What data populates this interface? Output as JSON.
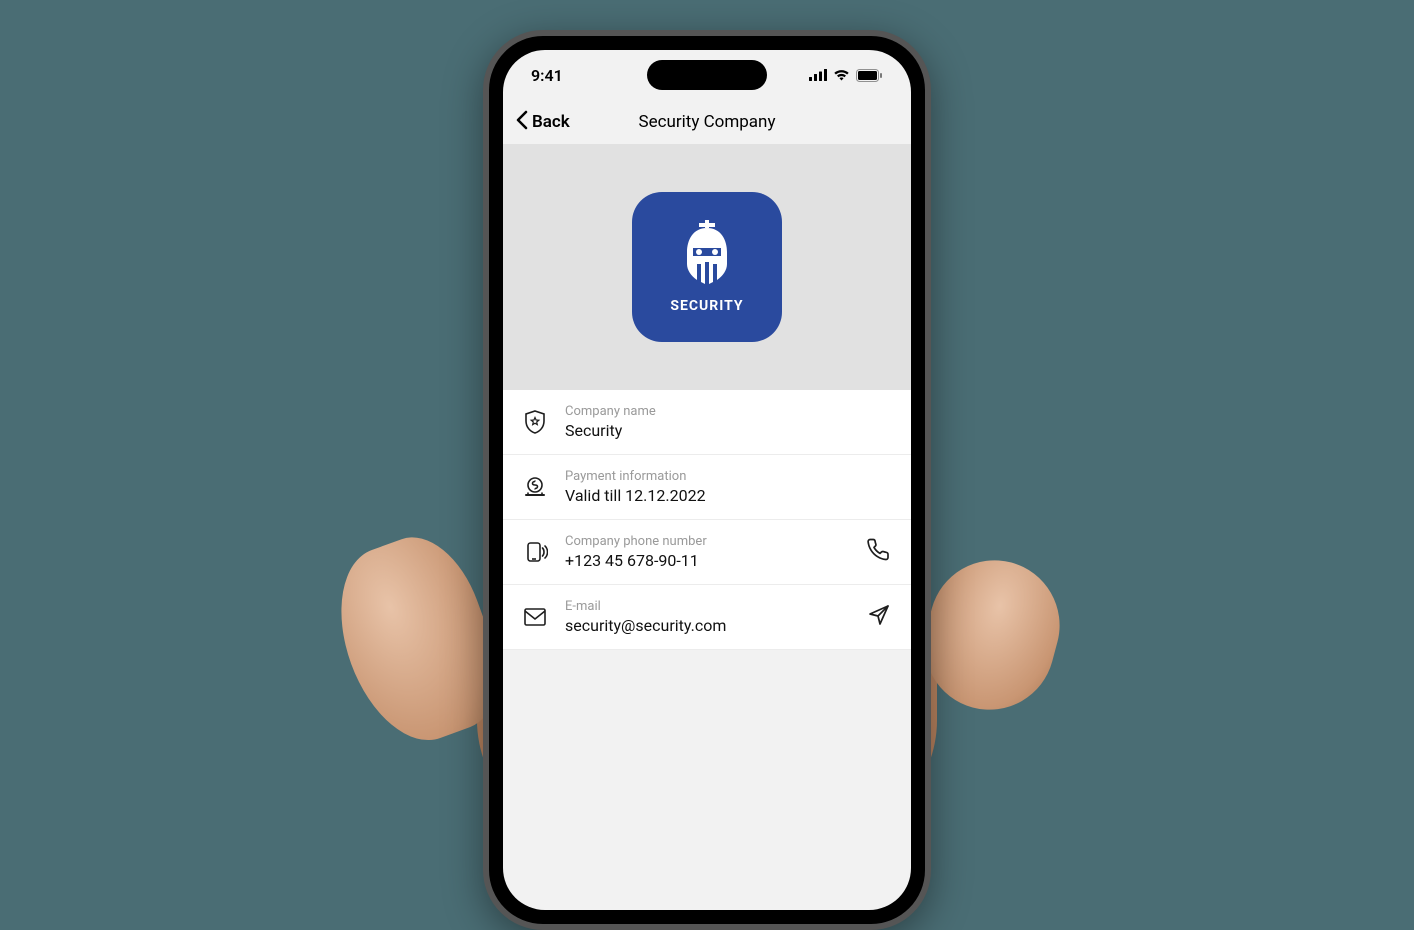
{
  "status": {
    "time": "9:41"
  },
  "nav": {
    "back_label": "Back",
    "title": "Security Company"
  },
  "logo": {
    "label": "SECURITY"
  },
  "rows": {
    "company_name": {
      "label": "Company name",
      "value": "Security"
    },
    "payment": {
      "label": "Payment information",
      "value": "Valid till 12.12.2022"
    },
    "phone": {
      "label": "Company phone number",
      "value": "+123 45 678-90-11"
    },
    "email": {
      "label": "E-mail",
      "value": "security@security.com"
    }
  }
}
